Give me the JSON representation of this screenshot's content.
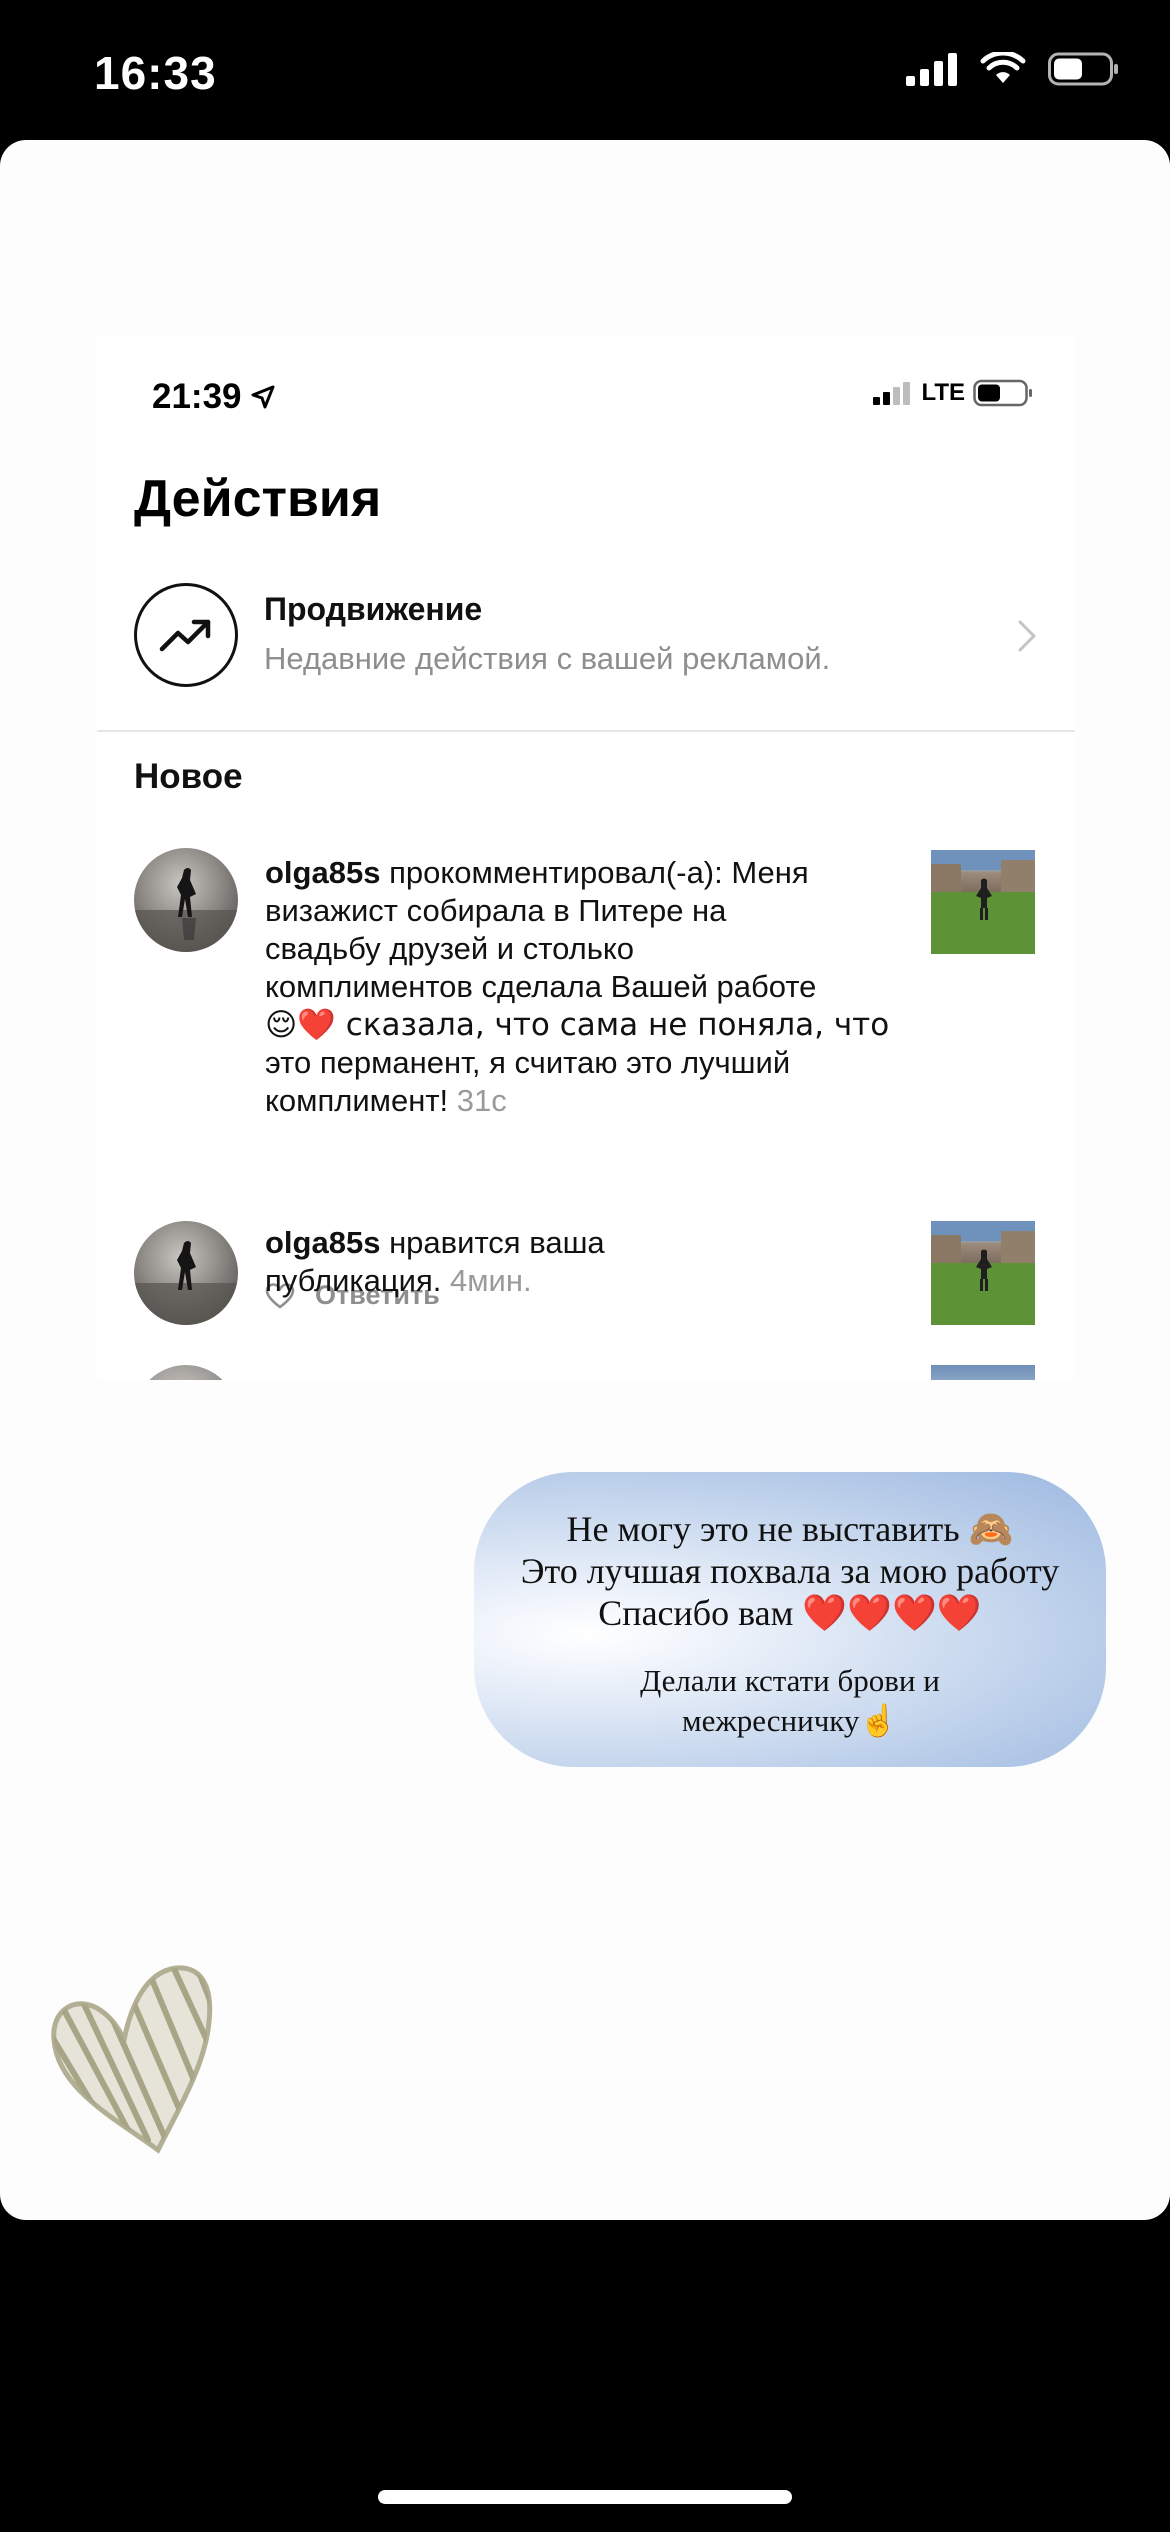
{
  "outer_status": {
    "time": "16:33",
    "icons": [
      "cellular-signal-icon",
      "wifi-icon",
      "battery-icon"
    ]
  },
  "inner_screen": {
    "status": {
      "time": "21:39",
      "network": "LTE",
      "icons": [
        "location-arrow-icon",
        "cellular-signal-icon",
        "battery-icon"
      ]
    },
    "title": "Действия",
    "promotion": {
      "title": "Продвижение",
      "subtitle": "Недавние действия с вашей рекламой.",
      "icon": "trending-up-icon"
    },
    "section_title": "Новое",
    "notifications": [
      {
        "username": "olga85s",
        "lines": [
          " прокомментировал(-а): Меня",
          "визажист собирала в Питере на",
          "свадьбу друзей и столько",
          "комплиментов сделала Вашей работе",
          "😌❤️ сказала, что сама не поняла, что",
          "это перманент, я считаю это лучший",
          "комплимент! "
        ],
        "time": "31с",
        "reply_label": "Ответить"
      },
      {
        "username": "olga85s",
        "lines": [
          " нравится ваша",
          "публикация. "
        ],
        "time": "4мин."
      }
    ]
  },
  "caption": {
    "line1": "Не могу это не выставить 🙈",
    "line2": "Это лучшая похвала за мою работу",
    "line3": "Спасибо вам ❤️❤️❤️❤️",
    "line4": "Делали кстати брови и",
    "line5": "межресничку☝️"
  },
  "colors": {
    "accent_heart": "#d72030",
    "bubble_blue": "#9cb8e0",
    "heart_sticker": "#b8b49a"
  }
}
